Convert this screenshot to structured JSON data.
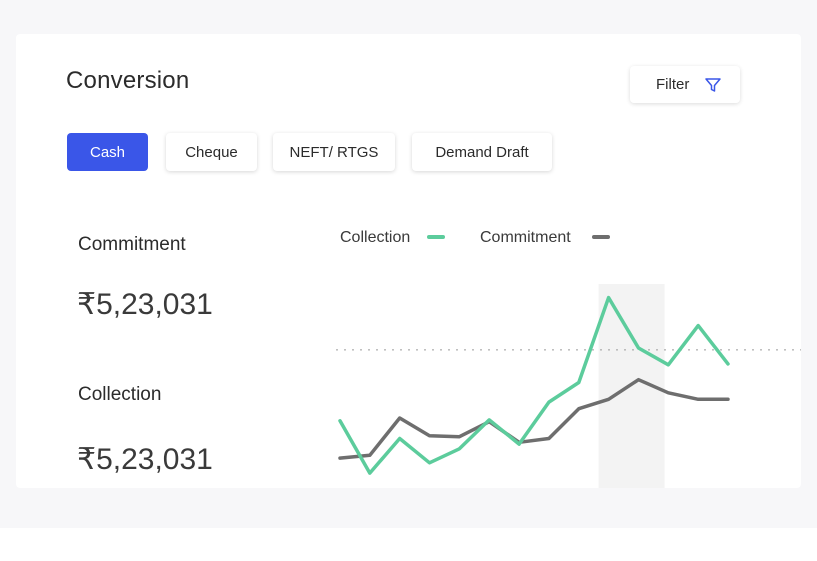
{
  "card": {
    "title": "Conversion",
    "filter_label": "Filter"
  },
  "tabs": [
    {
      "label": "Cash",
      "active": true
    },
    {
      "label": "Cheque",
      "active": false
    },
    {
      "label": "NEFT/ RTGS",
      "active": false
    },
    {
      "label": "Demand Draft",
      "active": false
    }
  ],
  "stats": {
    "commitment_label": "Commitment",
    "commitment_value": "₹5,23,031",
    "collection_label": "Collection",
    "collection_value": "₹5,23,031"
  },
  "colors": {
    "accent": "#3a56e8",
    "collection": "#5ccc9c",
    "commitment": "#6e6e6e",
    "highlight": "#f3f3f3"
  },
  "icons": {
    "filter": "filter-funnel-icon"
  },
  "chart_data": {
    "type": "line",
    "legend": [
      "Collection",
      "Commitment"
    ],
    "legend_position": "top",
    "series": [
      {
        "name": "Collection",
        "values": [
          72,
          16,
          53,
          27,
          42,
          73,
          47,
          92,
          113,
          204,
          150,
          132,
          174,
          133
        ]
      },
      {
        "name": "Commitment",
        "values": [
          32,
          35,
          75,
          56,
          55,
          71,
          49,
          53,
          85,
          95,
          116,
          102,
          95,
          95
        ]
      }
    ],
    "reference_line": 148,
    "ylim": [
      0,
      240
    ],
    "highlight_index": 9
  }
}
